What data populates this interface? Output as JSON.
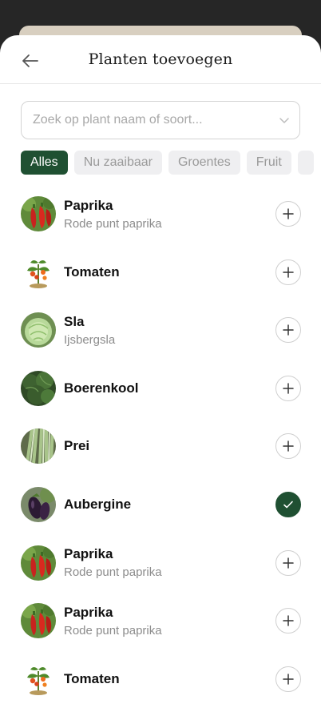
{
  "header": {
    "title": "Planten toevoegen"
  },
  "search": {
    "placeholder": "Zoek op plant naam of soort..."
  },
  "filters": [
    {
      "label": "Alles",
      "active": true
    },
    {
      "label": "Nu zaaibaar",
      "active": false
    },
    {
      "label": "Groentes",
      "active": false
    },
    {
      "label": "Fruit",
      "active": false
    }
  ],
  "colors": {
    "accent": "#1f5032",
    "chip_bg": "#efeff1",
    "muted_text": "#8c8c8c"
  },
  "plants": [
    {
      "name": "Paprika",
      "variety": "Rode punt paprika",
      "icon": "pepper-photo",
      "added": false
    },
    {
      "name": "Tomaten",
      "variety": "",
      "icon": "tomato-plant-photo",
      "added": false
    },
    {
      "name": "Sla",
      "variety": "Ijsbergsla",
      "icon": "lettuce-photo",
      "added": false
    },
    {
      "name": "Boerenkool",
      "variety": "",
      "icon": "kale-photo",
      "added": false
    },
    {
      "name": "Prei",
      "variety": "",
      "icon": "leek-photo",
      "added": false
    },
    {
      "name": "Aubergine",
      "variety": "",
      "icon": "eggplant-photo",
      "added": true
    },
    {
      "name": "Paprika",
      "variety": "Rode punt paprika",
      "icon": "pepper-photo",
      "added": false
    },
    {
      "name": "Paprika",
      "variety": "Rode punt paprika",
      "icon": "pepper-photo",
      "added": false
    },
    {
      "name": "Tomaten",
      "variety": "",
      "icon": "tomato-plant-photo",
      "added": false
    }
  ]
}
